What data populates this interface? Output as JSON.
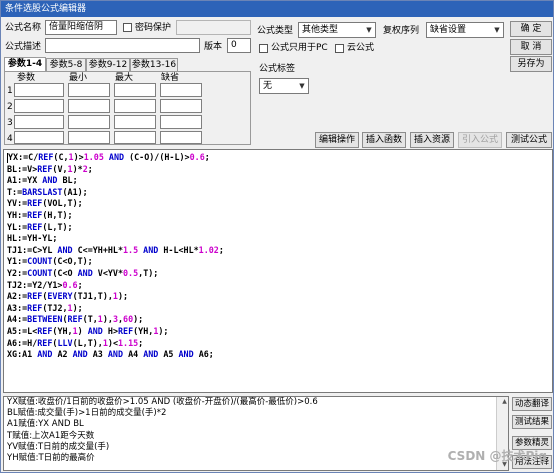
{
  "window": {
    "title": "条件选股公式编辑器"
  },
  "form": {
    "name_label": "公式名称",
    "name_value": "倍量阳缩倍阴",
    "password_label": "密码保护",
    "desc_label": "公式描述",
    "desc_value": "",
    "version_label": "版本",
    "version_value": "0",
    "type_label": "公式类型",
    "type_value": "其他类型",
    "rights_label": "复权序列",
    "rights_value": "缺省设置",
    "pc_only_label": "公式只用于PC",
    "cloud_label": "云公式",
    "tag_label": "公式标签",
    "tag_value": "无"
  },
  "buttons": {
    "ok": "确 定",
    "cancel": "取 消",
    "save_as": "另存为",
    "edit_op": "编辑操作",
    "insert_fn": "插入函数",
    "insert_res": "插入资源",
    "import_formula": "引入公式",
    "test_formula": "测试公式"
  },
  "tabs": [
    "参数1-4",
    "参数5-8",
    "参数9-12",
    "参数13-16"
  ],
  "params": {
    "headers": [
      "参数",
      "最小",
      "最大",
      "缺省"
    ],
    "rows": [
      "1",
      "2",
      "3",
      "4"
    ]
  },
  "code_lines": [
    "YX:=C/REF(C,1)>1.05 AND (C-O)/(H-L)>0.6;",
    "BL:=V>REF(V,1)*2;",
    "A1:=YX AND BL;",
    "T:=BARSLAST(A1);",
    "YV:=REF(VOL,T);",
    "YH:=REF(H,T);",
    "YL:=REF(L,T);",
    "HL:=YH-YL;",
    "TJ1:=C>YL AND C<=YH+HL*1.5 AND H-L<HL*1.02;",
    "Y1:=COUNT(C<O,T);",
    "Y2:=COUNT(C<O AND V<YV*0.5,T);",
    "TJ2:=Y2/Y1>0.6;",
    "A2:=REF(EVERY(TJ1,T),1);",
    "A3:=REF(TJ2,1);",
    "A4:=BETWEEN(REF(T,1),3,60);",
    "A5:=L<REF(YH,1) AND H>REF(YH,1);",
    "A6:=H/REF(LLV(L,T),1)<1.15;",
    "XG:A1 AND A2 AND A3 AND A4 AND A5 AND A6;"
  ],
  "info_lines": [
    "YX赋值:收盘价/1日前的收盘价>1.05 AND (收盘价-开盘价)/(最高价-最低价)>0.6",
    "BL赋值:成交量(手)>1日前的成交量(手)*2",
    "A1赋值:YX AND BL",
    "T赋值:上次A1距今天数",
    "YV赋值:T日前的成交量(手)",
    "YH赋值:T日前的最高价"
  ],
  "side_buttons": [
    "动态翻译",
    "测试结果",
    "参数精灵",
    "用法注释"
  ],
  "watermark": "CSDN @技术Pig"
}
